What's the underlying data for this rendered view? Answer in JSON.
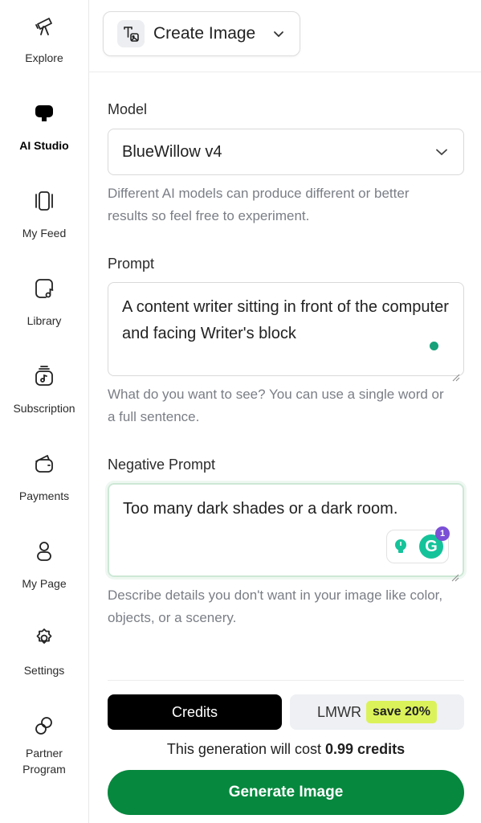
{
  "sidebar": {
    "items": [
      {
        "label": "Explore",
        "icon": "telescope-icon"
      },
      {
        "label": "AI Studio",
        "icon": "ai-studio-icon",
        "active": true
      },
      {
        "label": "My Feed",
        "icon": "feed-icon"
      },
      {
        "label": "Library",
        "icon": "library-icon"
      },
      {
        "label": "Subscription",
        "icon": "subscription-icon"
      },
      {
        "label": "Payments",
        "icon": "wallet-icon"
      },
      {
        "label": "My Page",
        "icon": "user-icon"
      },
      {
        "label": "Settings",
        "icon": "gear-icon"
      },
      {
        "label": "Partner",
        "label2": "Program",
        "icon": "partner-icon"
      }
    ]
  },
  "mode": {
    "label": "Create Image",
    "icon": "text-to-image-icon"
  },
  "model": {
    "label": "Model",
    "value": "BlueWillow v4",
    "help": "Different AI models can produce different or better results so feel free to experiment."
  },
  "prompt": {
    "label": "Prompt",
    "value": "A content writer sitting in front of the computer and facing Writer's block",
    "help": "What do you want to see? You can use a single word or a full sentence."
  },
  "negative_prompt": {
    "label": "Negative Prompt",
    "value": "Too many dark shades or a dark room.",
    "help": "Describe details you don't want in your image like color, objects, or a scenery.",
    "grammarly_count": "1"
  },
  "billing": {
    "credits_tab": "Credits",
    "lmwr_tab": "LMWR",
    "save_badge": "save 20%",
    "cost_prefix": "This generation will cost",
    "cost_value": "0.99 credits"
  },
  "generate_button": "Generate Image",
  "colors": {
    "accent_green": "#06883e",
    "save_badge": "#dcf25a",
    "grammarly_green": "#15c39a",
    "grammarly_badge": "#7b4fd6"
  }
}
